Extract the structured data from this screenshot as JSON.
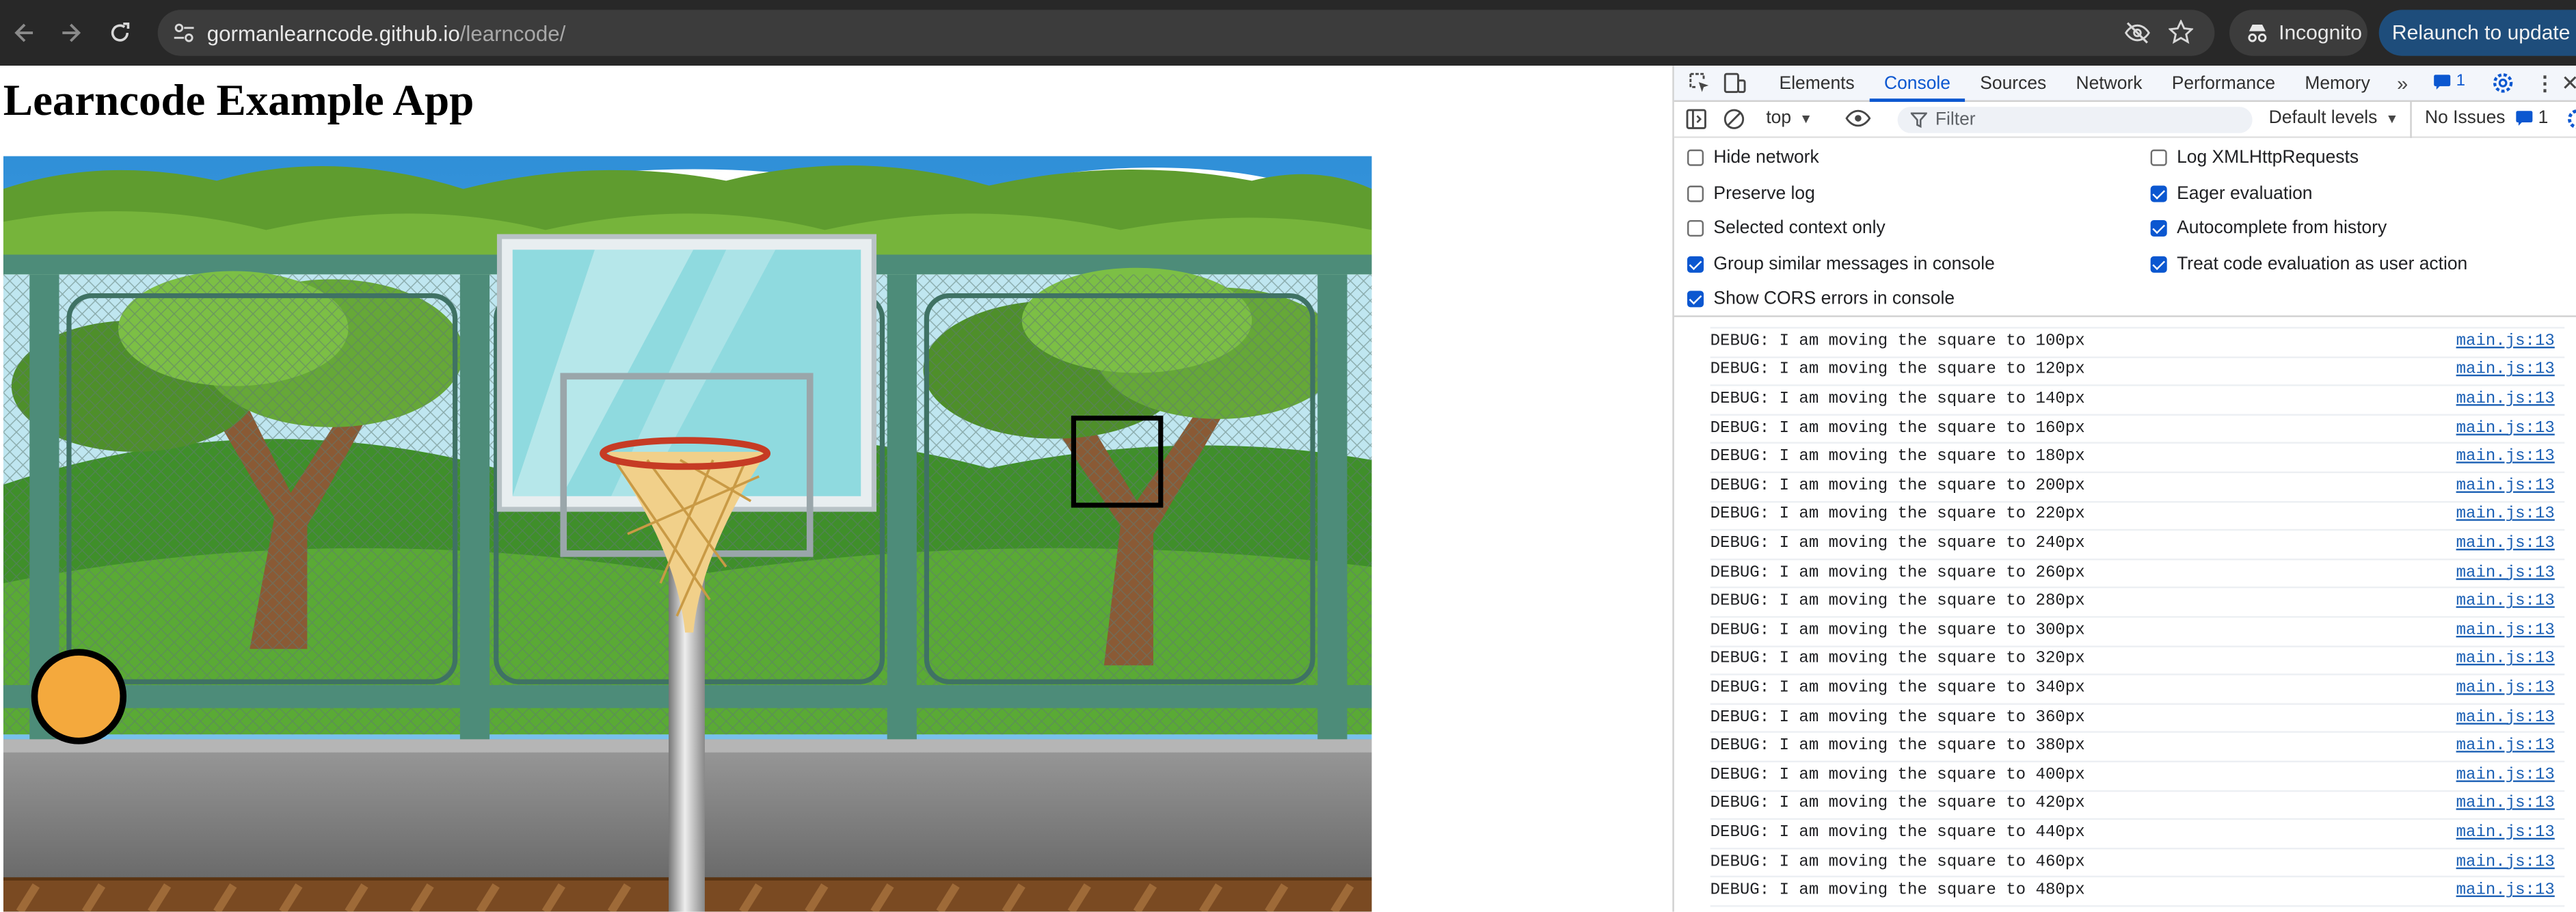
{
  "browser": {
    "url_host": "gormanlearncode.github.io",
    "url_path": "/learncode/",
    "incognito_label": "Incognito",
    "relaunch_label": "Relaunch to update"
  },
  "page": {
    "title": "Learncode Example App"
  },
  "devtools": {
    "tabs": [
      "Elements",
      "Console",
      "Sources",
      "Network",
      "Performance",
      "Memory"
    ],
    "active_tab": "Console",
    "issues_badge": "1",
    "context": "top",
    "filter_placeholder": "Filter",
    "levels": "Default levels",
    "no_issues": "No Issues",
    "no_issues_count": "1",
    "settings_left": [
      {
        "label": "Hide network",
        "checked": false
      },
      {
        "label": "Preserve log",
        "checked": false
      },
      {
        "label": "Selected context only",
        "checked": false
      },
      {
        "label": "Group similar messages in console",
        "checked": true
      },
      {
        "label": "Show CORS errors in console",
        "checked": true
      }
    ],
    "settings_right": [
      {
        "label": "Log XMLHttpRequests",
        "checked": false
      },
      {
        "label": "Eager evaluation",
        "checked": true
      },
      {
        "label": "Autocomplete from history",
        "checked": true
      },
      {
        "label": "Treat code evaluation as user action",
        "checked": true
      }
    ],
    "log_source": "main.js:13",
    "log_entries": [
      "DEBUG: I am moving the square to 100px",
      "DEBUG: I am moving the square to 120px",
      "DEBUG: I am moving the square to 140px",
      "DEBUG: I am moving the square to 160px",
      "DEBUG: I am moving the square to 180px",
      "DEBUG: I am moving the square to 200px",
      "DEBUG: I am moving the square to 220px",
      "DEBUG: I am moving the square to 240px",
      "DEBUG: I am moving the square to 260px",
      "DEBUG: I am moving the square to 280px",
      "DEBUG: I am moving the square to 300px",
      "DEBUG: I am moving the square to 320px",
      "DEBUG: I am moving the square to 340px",
      "DEBUG: I am moving the square to 360px",
      "DEBUG: I am moving the square to 380px",
      "DEBUG: I am moving the square to 400px",
      "DEBUG: I am moving the square to 420px",
      "DEBUG: I am moving the square to 440px",
      "DEBUG: I am moving the square to 460px",
      "DEBUG: I am moving the square to 480px"
    ]
  },
  "colors": {
    "ball": "#f4a93d",
    "accent": "#0b57d0",
    "browser_chrome": "#282828"
  }
}
